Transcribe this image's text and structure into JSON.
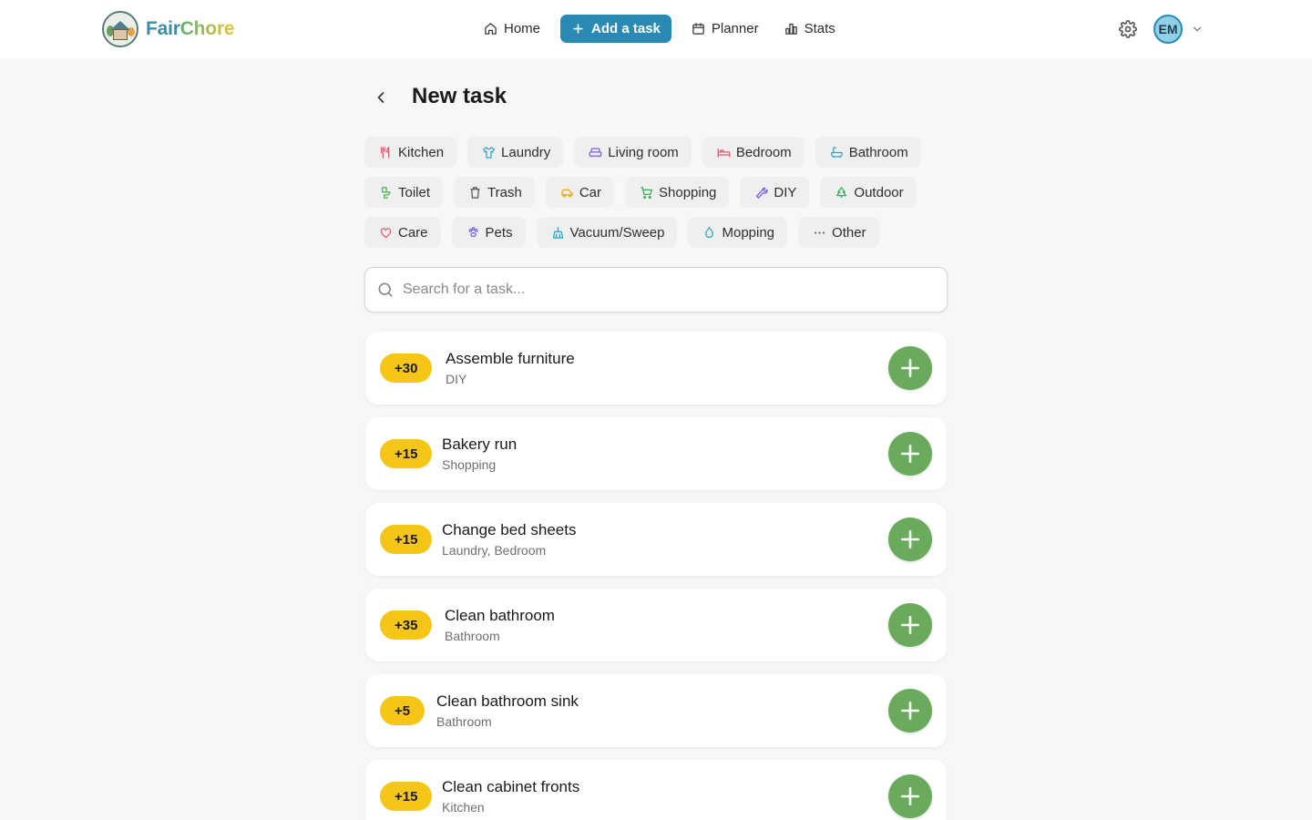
{
  "app": {
    "brand_part1": "Fair",
    "brand_part2": "Chore"
  },
  "nav": {
    "items": [
      {
        "label": "Home",
        "icon": "home-icon"
      },
      {
        "label": "Add a task",
        "icon": "plus-icon",
        "active": true
      },
      {
        "label": "Planner",
        "icon": "calendar-icon"
      },
      {
        "label": "Stats",
        "icon": "bar-chart-icon"
      }
    ]
  },
  "user": {
    "initials": "EM"
  },
  "page": {
    "title": "New task"
  },
  "categories": [
    {
      "label": "Kitchen",
      "icon": "utensils-icon",
      "color": "#e05a6b"
    },
    {
      "label": "Laundry",
      "icon": "shirt-icon",
      "color": "#2fa3c9"
    },
    {
      "label": "Living room",
      "icon": "sofa-icon",
      "color": "#7b5fe0"
    },
    {
      "label": "Bedroom",
      "icon": "bed-icon",
      "color": "#e05a6b"
    },
    {
      "label": "Bathroom",
      "icon": "bathtub-icon",
      "color": "#2fa3c9"
    },
    {
      "label": "Toilet",
      "icon": "toilet-icon",
      "color": "#4caf50"
    },
    {
      "label": "Trash",
      "icon": "trash-icon",
      "color": "#555555"
    },
    {
      "label": "Car",
      "icon": "car-icon",
      "color": "#e6a817"
    },
    {
      "label": "Shopping",
      "icon": "cart-icon",
      "color": "#3aa85c"
    },
    {
      "label": "DIY",
      "icon": "wrench-icon",
      "color": "#7b5fe0"
    },
    {
      "label": "Outdoor",
      "icon": "tree-icon",
      "color": "#3aa85c"
    },
    {
      "label": "Care",
      "icon": "heart-icon",
      "color": "#e05a6b"
    },
    {
      "label": "Pets",
      "icon": "paw-icon",
      "color": "#7b5fe0"
    },
    {
      "label": "Vacuum/Sweep",
      "icon": "vacuum-icon",
      "color": "#2fa3c9"
    },
    {
      "label": "Mopping",
      "icon": "droplet-icon",
      "color": "#2fa3c9"
    },
    {
      "label": "Other",
      "icon": "dots-icon",
      "color": "#555555"
    }
  ],
  "search": {
    "placeholder": "Search for a task..."
  },
  "tasks": [
    {
      "points": "+30",
      "name": "Assemble furniture",
      "category": "DIY"
    },
    {
      "points": "+15",
      "name": "Bakery run",
      "category": "Shopping"
    },
    {
      "points": "+15",
      "name": "Change bed sheets",
      "category": "Laundry, Bedroom"
    },
    {
      "points": "+35",
      "name": "Clean bathroom",
      "category": "Bathroom"
    },
    {
      "points": "+5",
      "name": "Clean bathroom sink",
      "category": "Bathroom"
    },
    {
      "points": "+15",
      "name": "Clean cabinet fronts",
      "category": "Kitchen"
    }
  ],
  "colors": {
    "accent": "#2a8ab3",
    "points_badge": "#f5c518",
    "add_button": "#6aaa5c"
  }
}
